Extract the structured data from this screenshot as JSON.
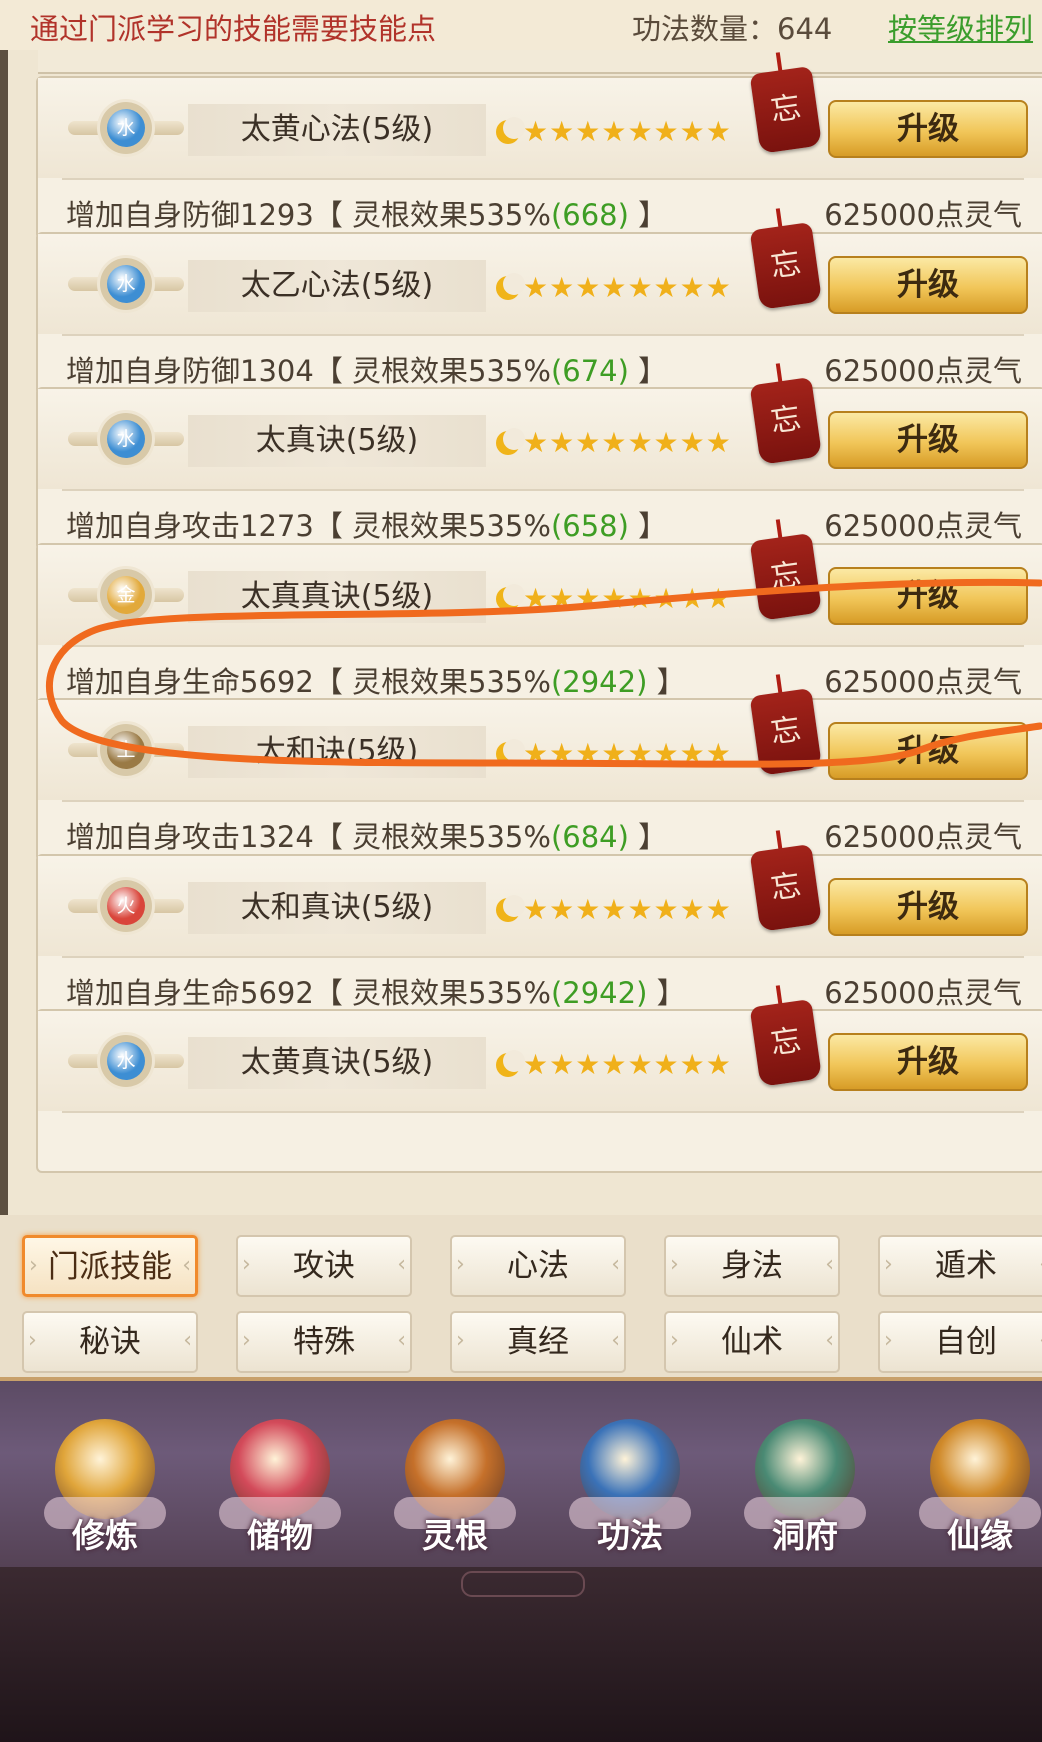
{
  "header": {
    "hint": "通过门派学习的技能需要技能点",
    "count_label": "功法数量：644",
    "sort_link": "按等级排列"
  },
  "skills": [
    {
      "element": "水",
      "element_color": "#3d8ed3",
      "name": "太黄心法(5级)",
      "stat": "增加自身防御1293",
      "effect": "【 灵根效果535%",
      "bonus": "(668)",
      "close": " 】",
      "cost": "625000点灵气",
      "tag": "忘",
      "upgrade_label": "升级"
    },
    {
      "element": "水",
      "element_color": "#3d8ed3",
      "name": "太乙心法(5级)",
      "stat": "增加自身防御1304",
      "effect": "【 灵根效果535%",
      "bonus": "(674)",
      "close": " 】",
      "cost": "625000点灵气",
      "tag": "忘",
      "upgrade_label": "升级"
    },
    {
      "element": "水",
      "element_color": "#3d8ed3",
      "name": "太真诀(5级)",
      "stat": "增加自身攻击1273",
      "effect": "【 灵根效果535%",
      "bonus": "(658)",
      "close": " 】",
      "cost": "625000点灵气",
      "tag": "忘",
      "upgrade_label": "升级"
    },
    {
      "element": "金",
      "element_color": "#e2a93a",
      "name": "太真真诀(5级)",
      "stat": "增加自身生命5692",
      "effect": "【 灵根效果535%",
      "bonus": "(2942)",
      "close": " 】",
      "cost": "625000点灵气",
      "tag": "忘",
      "upgrade_label": "升级"
    },
    {
      "element": "土",
      "element_color": "#9a7a45",
      "name": "太和诀(5级)",
      "stat": "增加自身攻击1324",
      "effect": "【 灵根效果535%",
      "bonus": "(684)",
      "close": " 】",
      "cost": "625000点灵气",
      "tag": "忘",
      "upgrade_label": "升级"
    },
    {
      "element": "火",
      "element_color": "#d9453b",
      "name": "太和真诀(5级)",
      "stat": "增加自身生命5692",
      "effect": "【 灵根效果535%",
      "bonus": "(2942)",
      "close": " 】",
      "cost": "625000点灵气",
      "tag": "忘",
      "upgrade_label": "升级"
    },
    {
      "element": "水",
      "element_color": "#3d8ed3",
      "name": "太黄真诀(5级)",
      "stat": "",
      "effect": "",
      "bonus": "",
      "close": "",
      "cost": "",
      "tag": "忘",
      "upgrade_label": "升级"
    }
  ],
  "stars": {
    "moons": 1,
    "stars": 8
  },
  "tabs": {
    "row1": [
      "门派技能",
      "攻诀",
      "心法",
      "身法",
      "遁术"
    ],
    "row2": [
      "秘诀",
      "特殊",
      "真经",
      "仙术",
      "自创"
    ],
    "active": "门派技能"
  },
  "nav": [
    {
      "label": "修炼",
      "icon": "cultivate-icon",
      "color": "#e0a53a"
    },
    {
      "label": "储物",
      "icon": "storage-bag-icon",
      "color": "#d34a5a"
    },
    {
      "label": "灵根",
      "icon": "spirit-root-icon",
      "color": "#c5702a"
    },
    {
      "label": "功法",
      "icon": "skill-book-icon",
      "color": "#3a72b8"
    },
    {
      "label": "洞府",
      "icon": "cave-dwelling-icon",
      "color": "#4a8a74"
    },
    {
      "label": "仙缘",
      "icon": "gourd-icon",
      "color": "#d08a2a"
    }
  ],
  "colors": {
    "accent_orange": "#f08a2c",
    "bonus_green": "#3e9d24",
    "hint_red": "#b1332a",
    "annotation": "#f06a1e"
  }
}
